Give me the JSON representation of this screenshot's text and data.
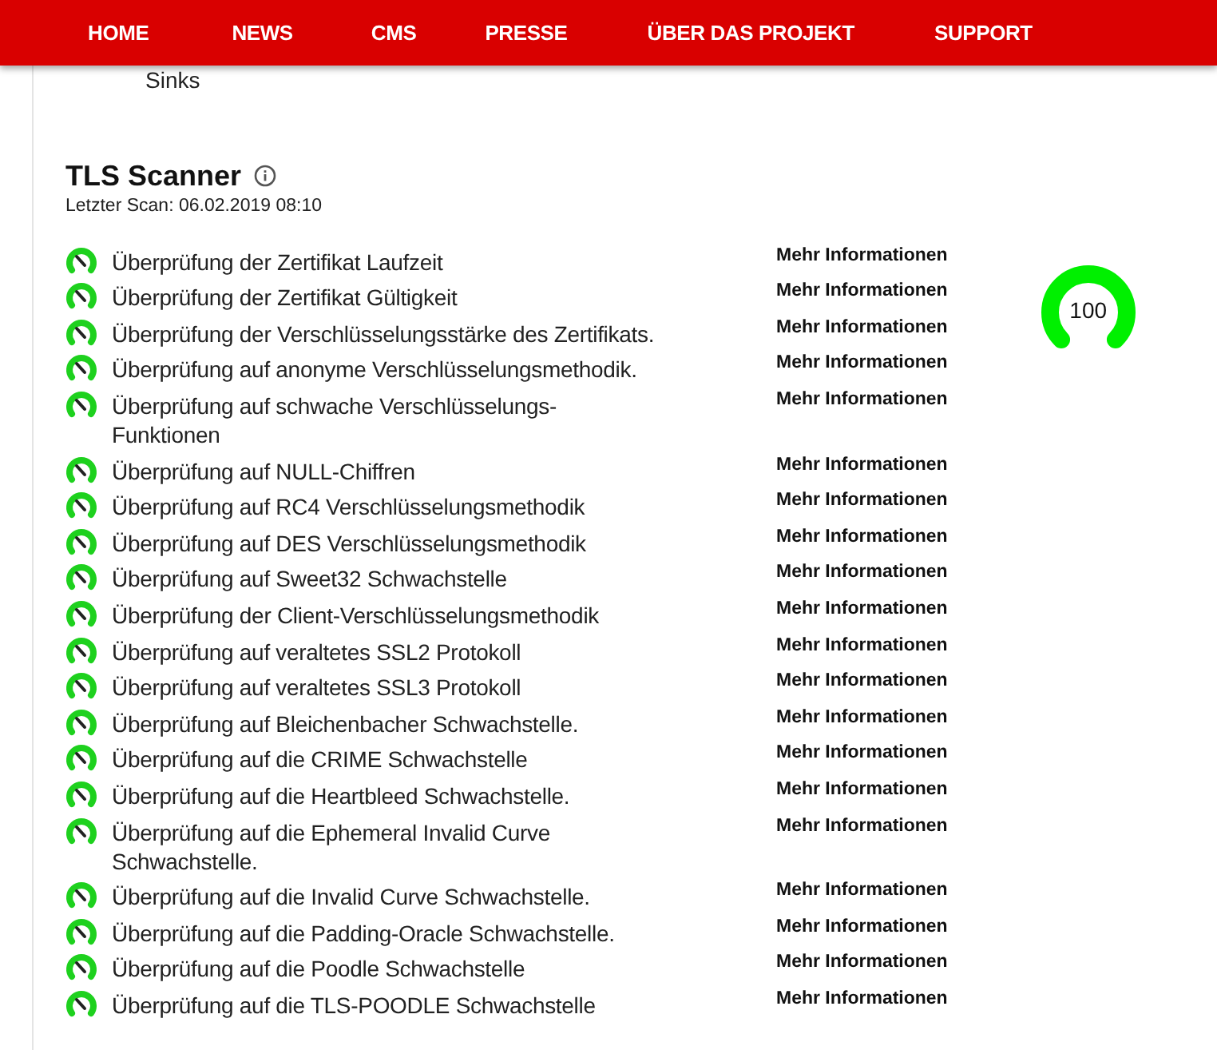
{
  "nav": {
    "items": [
      {
        "label": "HOME"
      },
      {
        "label": "NEWS"
      },
      {
        "label": "CMS"
      },
      {
        "label": "PRESSE"
      },
      {
        "label": "ÜBER DAS PROJEKT"
      },
      {
        "label": "SUPPORT"
      }
    ]
  },
  "previous_section": {
    "text": "Sinks"
  },
  "scanner": {
    "title": "TLS Scanner",
    "last_scan": "Letzter Scan: 06.02.2019 08:10",
    "score": {
      "reading": "100",
      "level": 1
    },
    "checks": [
      {
        "label": "Überprüfung der Zertifikat Laufzeit",
        "link": "Mehr Informationen"
      },
      {
        "label": "Überprüfung der Zertifikat Gültigkeit",
        "link": "Mehr Informationen"
      },
      {
        "label": "Überprüfung der Verschlüsselungsstärke des Zertifikats.",
        "link": "Mehr Informationen"
      },
      {
        "label": "Überprüfung auf anonyme Verschlüsselungsmethodik.",
        "link": "Mehr Informationen"
      },
      {
        "label": "Überprüfung auf schwache Verschlüsselungs-Funktionen",
        "link": "Mehr Informationen"
      },
      {
        "label": "Überprüfung auf NULL-Chiffren",
        "link": "Mehr Informationen"
      },
      {
        "label": "Überprüfung auf RC4 Verschlüsselungsmethodik",
        "link": "Mehr Informationen"
      },
      {
        "label": "Überprüfung auf DES Verschlüsselungsmethodik",
        "link": "Mehr Informationen"
      },
      {
        "label": "Überprüfung auf Sweet32 Schwachstelle",
        "link": "Mehr Informationen"
      },
      {
        "label": "Überprüfung der Client-Verschlüsselungsmethodik",
        "link": "Mehr Informationen"
      },
      {
        "label": "Überprüfung auf veraltetes SSL2 Protokoll",
        "link": "Mehr Informationen"
      },
      {
        "label": "Überprüfung auf veraltetes SSL3 Protokoll",
        "link": "Mehr Informationen"
      },
      {
        "label": "Überprüfung auf Bleichenbacher Schwachstelle.",
        "link": "Mehr Informationen"
      },
      {
        "label": "Überprüfung auf die CRIME Schwachstelle",
        "link": "Mehr Informationen"
      },
      {
        "label": "Überprüfung auf die Heartbleed Schwachstelle.",
        "link": "Mehr Informationen"
      },
      {
        "label": "Überprüfung auf die Ephemeral Invalid Curve Schwachstelle.",
        "link": "Mehr Informationen"
      },
      {
        "label": "Überprüfung auf die Invalid Curve Schwachstelle.",
        "link": "Mehr Informationen"
      },
      {
        "label": "Überprüfung auf die Padding-Oracle Schwachstelle.",
        "link": "Mehr Informationen"
      },
      {
        "label": "Überprüfung auf die Poodle Schwachstelle",
        "link": "Mehr Informationen"
      },
      {
        "label": "Überprüfung auf die TLS-POODLE Schwachstelle",
        "link": "Mehr Informationen"
      }
    ]
  }
}
